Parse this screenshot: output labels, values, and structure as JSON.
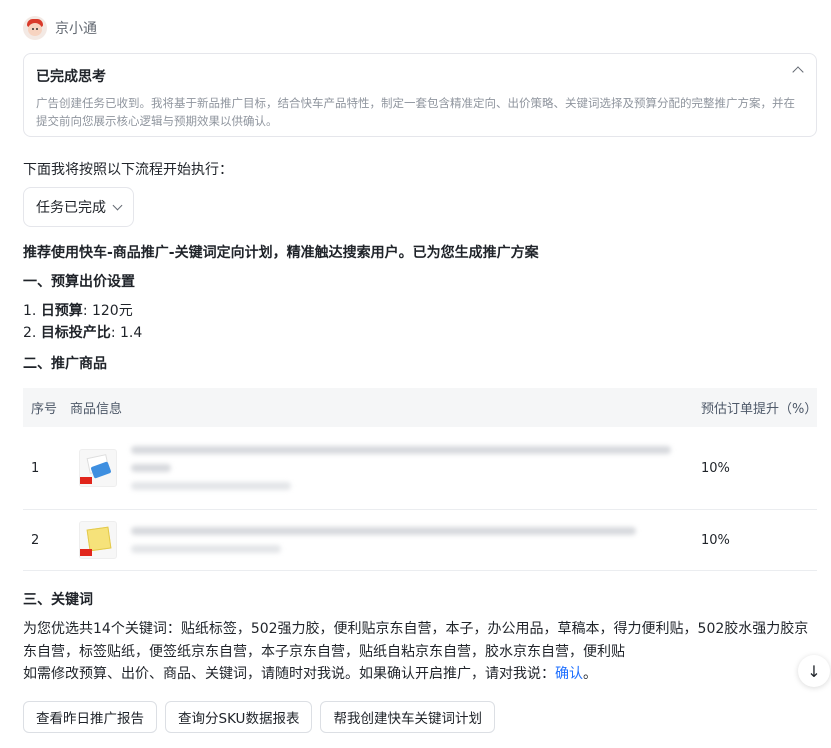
{
  "agent": {
    "name": "京小通"
  },
  "thinking": {
    "title": "已完成思考",
    "body": "广告创建任务已收到。我将基于新品推广目标，结合快车产品特性，制定一套包含精准定向、出价策略、关键词选择及预算分配的完整推广方案，并在提交前向您展示核心逻辑与预期效果以供确认。"
  },
  "flow_intro": "下面我将按照以下流程开始执行：",
  "task_status": "任务已完成",
  "recommendation": "推荐使用快车-商品推广-关键词定向计划，精准触达搜索用户。已为您生成推广方案",
  "section1": {
    "title": "一、预算出价设置",
    "items": [
      {
        "num": "1.",
        "label": "日预算",
        "value": ": 120元"
      },
      {
        "num": "2.",
        "label": "目标投产比",
        "value": ": 1.4"
      }
    ]
  },
  "section2": {
    "title": "二、推广商品",
    "headers": {
      "seq": "序号",
      "info": "商品信息",
      "pred": "预估订单提升（%）"
    },
    "rows": [
      {
        "seq": "1",
        "pred": "10%"
      },
      {
        "seq": "2",
        "pred": "10%"
      }
    ]
  },
  "section3": {
    "title": "三、关键词",
    "keywords_text": "为您优选共14个关键词：贴纸标签，502强力胶，便利贴京东自营，本子，办公用品，草稿本，得力便利贴，502胶水强力胶京东自营，标签贴纸，便签纸京东自营，本子京东自营，贴纸自粘京东自营，胶水京东自营，便利贴",
    "confirm_prefix": "如需修改预算、出价、商品、关键词，请随时对我说。如果确认开启推广，请对我说：",
    "confirm_link": "确认",
    "confirm_suffix": "。"
  },
  "scroll_icon": "↓",
  "actions": [
    "查看昨日推广报告",
    "查询分SKU数据报表",
    "帮我创建快车关键词计划"
  ]
}
